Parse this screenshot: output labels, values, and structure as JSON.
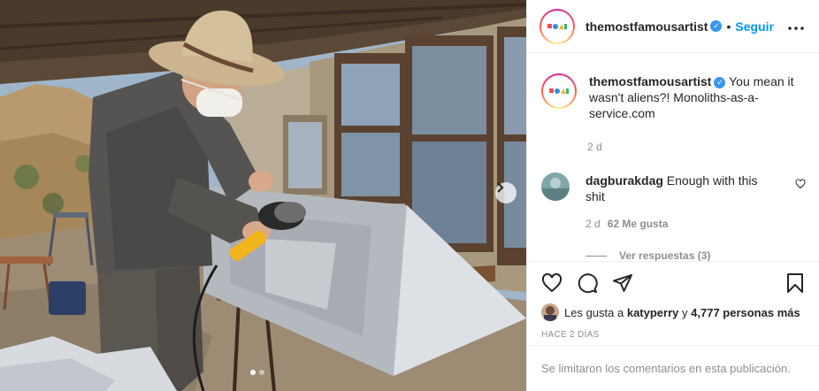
{
  "post": {
    "photo_alt": "",
    "carousel": {
      "dot_count": 2,
      "active_index": 0
    }
  },
  "header": {
    "username": "themostfamousartist",
    "separator": "•",
    "follow_label": "Seguir",
    "more_icon": "more-horizontal-icon"
  },
  "caption": {
    "username": "themostfamousartist",
    "text": "You mean it wasn't aliens?! Monoliths-as-a-service.com",
    "time": "2 d"
  },
  "comments": [
    {
      "username": "dagburakdag",
      "text": "Enough with this shit",
      "time": "2 d",
      "likes": "62 Me gusta",
      "replies": "Ver respuestas (3)"
    }
  ],
  "actions": {
    "icons": [
      "heart-icon",
      "comment-icon",
      "share-icon",
      "bookmark-icon"
    ]
  },
  "likes_summary": {
    "prefix": "Les gusta a",
    "user": "katyperry",
    "conj": "y",
    "count": "4,777 personas más"
  },
  "posted_ago": "HACE 2 DÍAS",
  "comments_limited": "Se limitaron los comentarios en esta publicación.",
  "colors": {
    "accent": "#0095f6",
    "verified": "#3897f0",
    "muted": "#8e8e8e",
    "text": "#262626"
  }
}
